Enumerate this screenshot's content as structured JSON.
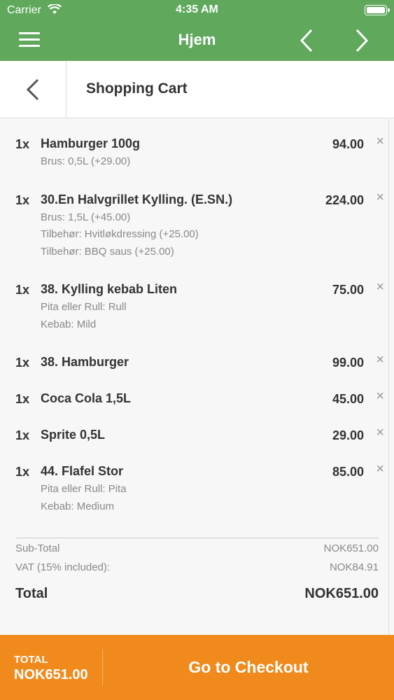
{
  "status_bar": {
    "carrier": "Carrier",
    "time": "4:35 AM"
  },
  "nav": {
    "title": "Hjem"
  },
  "header": {
    "title": "Shopping Cart"
  },
  "cart": {
    "items": [
      {
        "qty": "1x",
        "name": "Hamburger 100g",
        "price": "94.00",
        "options": [
          "Brus: 0,5L (+29.00)"
        ]
      },
      {
        "qty": "1x",
        "name": "30.En Halvgrillet Kylling. (E.SN.)",
        "price": "224.00",
        "options": [
          "Brus: 1,5L (+45.00)",
          "Tilbehør: Hvitløkdressing (+25.00)",
          "Tilbehør: BBQ saus (+25.00)"
        ]
      },
      {
        "qty": "1x",
        "name": "38. Kylling kebab Liten",
        "price": "75.00",
        "options": [
          "Pita eller Rull: Rull",
          "Kebab: Mild"
        ]
      },
      {
        "qty": "1x",
        "name": "38. Hamburger",
        "price": "99.00",
        "options": []
      },
      {
        "qty": "1x",
        "name": "Coca Cola 1,5L",
        "price": "45.00",
        "options": []
      },
      {
        "qty": "1x",
        "name": "Sprite 0,5L",
        "price": "29.00",
        "options": []
      },
      {
        "qty": "1x",
        "name": "44. Flafel Stor",
        "price": "85.00",
        "options": [
          "Pita eller Rull: Pita",
          "Kebab: Medium"
        ]
      }
    ],
    "remove_symbol": "×"
  },
  "summary": {
    "subtotal_label": "Sub-Total",
    "subtotal_value": "NOK651.00",
    "vat_label": "VAT (15% included):",
    "vat_value": "NOK84.91",
    "total_label": "Total",
    "total_value": "NOK651.00"
  },
  "footer": {
    "total_label": "TOTAL",
    "total_value": "NOK651.00",
    "checkout_label": "Go to Checkout"
  },
  "colors": {
    "accent_green": "#5fa85c",
    "checkout_orange": "#f08a1c"
  }
}
